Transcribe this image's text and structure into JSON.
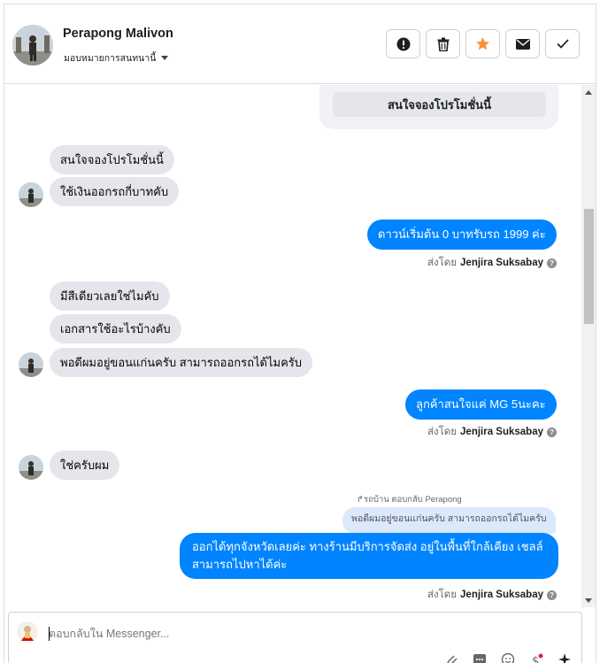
{
  "header": {
    "name": "Perapong Malivon",
    "assign_label": "มอบหมายการสนทนานี้",
    "actions": [
      "spam-icon",
      "trash-icon",
      "star-icon",
      "mail-icon",
      "check-icon"
    ]
  },
  "colors": {
    "accent": "#0084ff",
    "star": "#f7923a",
    "incoming": "#e4e6eb"
  },
  "card": {
    "button_label": "สนใจจองโปรโมชั่นนี้"
  },
  "messages": [
    {
      "dir": "in",
      "text": "สนใจจองโปรโมชั่นนี้"
    },
    {
      "dir": "in",
      "text": "ใช้เงินออกรถกี่บาทคับ"
    },
    {
      "dir": "out",
      "text": "ดาวน์เริ่มต้น 0 บาทรับรถ 1999 ค่ะ"
    },
    {
      "dir": "in",
      "text": "มีสีเดียวเลยใช่ไมคับ"
    },
    {
      "dir": "in",
      "text": "เอกสารใช้อะไรบ้างคับ"
    },
    {
      "dir": "in",
      "text": "พอดีผมอยู่ขอนแก่นครับ สามารถออกรถได้ไมครับ"
    },
    {
      "dir": "out",
      "text": "ลูกค้าสนใจแค่ MG 5นะคะ"
    },
    {
      "dir": "in",
      "text": "ใช่ครับผม"
    },
    {
      "dir": "out",
      "text": "ออกได้ทุกจังหวัดเลยค่ะ ทางร้านมีบริการจัดส่ง อยู่ในพื้นที่ใกล้เคียง เชลล์สามารถไปหาได้ค่ะ"
    }
  ],
  "sent_by": {
    "prefix": "ส่งโดย",
    "agent": "Jenjira Suksabay"
  },
  "reply": {
    "note": "รถบ้าน ตอบกลับ Perapong",
    "quoted": "พอดีผมอยู่ขอนแก่นครับ สามารถออกรถได้ไมครับ"
  },
  "composer": {
    "placeholder": "ตอบกลับใน Messenger...",
    "tools": [
      "attach-icon",
      "saved-reply-icon",
      "emoji-icon",
      "payment-icon",
      "ai-sparkle-icon"
    ]
  }
}
